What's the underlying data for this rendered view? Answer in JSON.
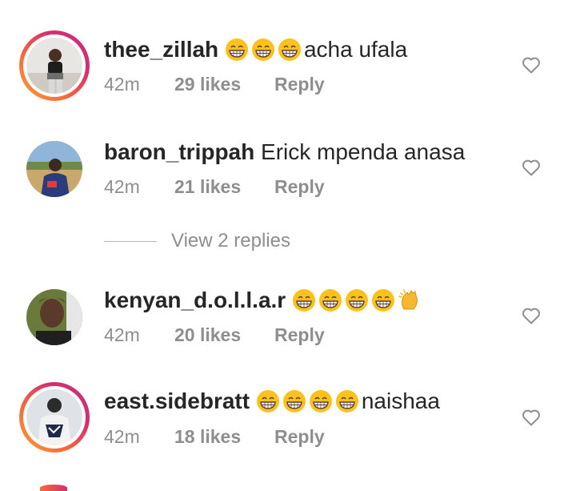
{
  "comments": [
    {
      "username": "thee_zillah",
      "emojis": [
        "grinning-face-with-smiling-eyes",
        "grinning-face-with-smiling-eyes",
        "grinning-face-with-smiling-eyes"
      ],
      "text": "acha ufala",
      "time": "42m",
      "likes": "29 likes",
      "reply": "Reply",
      "story_ring": true
    },
    {
      "username": "baron_trippah",
      "emojis": [],
      "text": "Erick mpenda anasa",
      "time": "42m",
      "likes": "21 likes",
      "reply": "Reply",
      "story_ring": false
    },
    {
      "username": "kenyan_d.o.l.l.a.r",
      "emojis": [
        "grinning-face-with-smiling-eyes",
        "grinning-face-with-smiling-eyes",
        "grinning-face-with-smiling-eyes",
        "grinning-face-with-smiling-eyes",
        "clapping-hands"
      ],
      "text": "",
      "time": "42m",
      "likes": "20 likes",
      "reply": "Reply",
      "story_ring": false
    },
    {
      "username": "east.sidebratt",
      "emojis": [
        "grinning-face-with-smiling-eyes",
        "grinning-face-with-smiling-eyes",
        "grinning-face-with-smiling-eyes",
        "grinning-face-with-smiling-eyes"
      ],
      "text": "naishaa",
      "time": "42m",
      "likes": "18 likes",
      "reply": "Reply",
      "story_ring": true
    }
  ],
  "view_replies": "View 2 replies",
  "icons": {
    "like": "heart-outline-icon"
  },
  "colors": {
    "username": "#262626",
    "meta": "#8e8e8e",
    "divider": "#b5b5b5",
    "ring_start": "#f9a33a",
    "ring_end": "#c13584"
  }
}
